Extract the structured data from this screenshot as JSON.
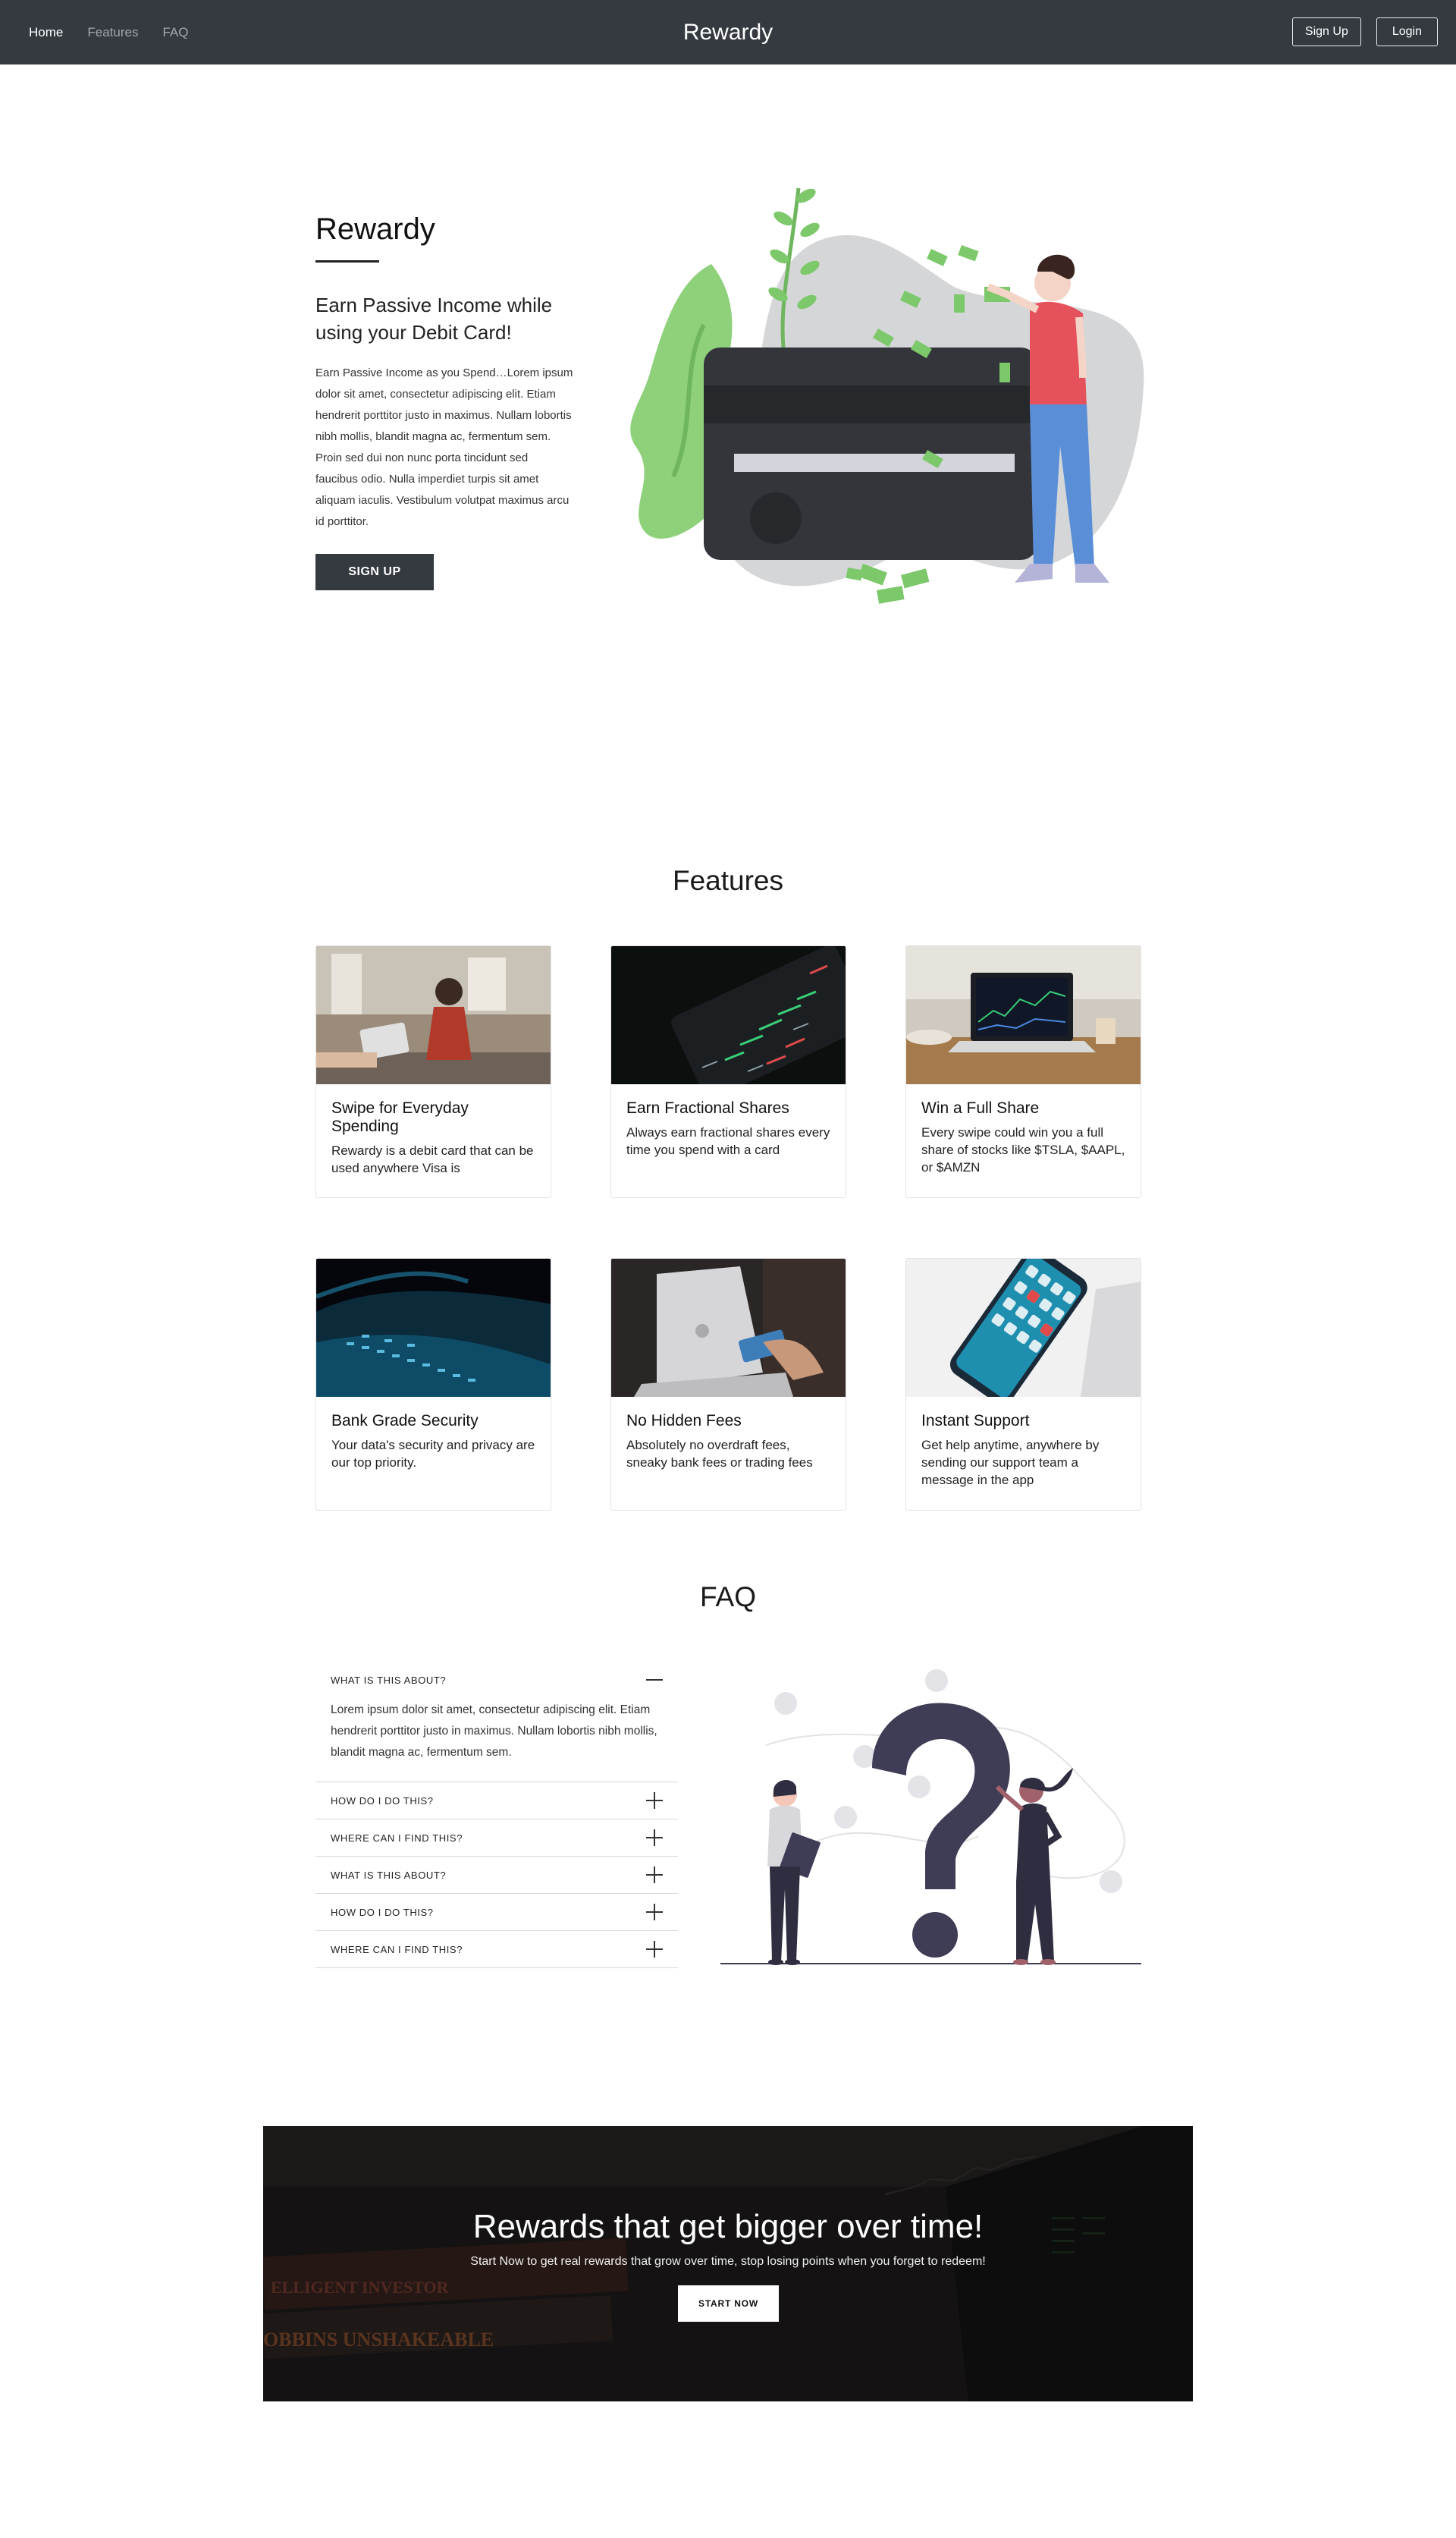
{
  "nav": {
    "links": [
      "Home",
      "Features",
      "FAQ"
    ],
    "brand": "Rewardy",
    "signup": "Sign Up",
    "login": "Login"
  },
  "hero": {
    "title": "Rewardy",
    "subtitle": "Earn Passive Income while using your Debit Card!",
    "body": "Earn Passive Income as you Spend…Lorem ipsum dolor sit amet, consectetur adipiscing elit. Etiam hendrerit porttitor justo in maximus. Nullam lobortis nibh mollis, blandit magna ac, fermentum sem. Proin sed dui non nunc porta tincidunt sed faucibus odio. Nulla imperdiet turpis sit amet aliquam iaculis. Vestibulum volutpat maximus arcu id porttitor.",
    "button": "SIGN UP"
  },
  "features": {
    "title": "Features",
    "cards": [
      {
        "title": "Swipe for Everyday Spending",
        "text": "Rewardy is a debit card that can be used anywhere Visa is"
      },
      {
        "title": "Earn Fractional Shares",
        "text": "Always earn fractional shares every time you spend with a card"
      },
      {
        "title": "Win a Full Share",
        "text": "Every swipe could win you a full share of stocks like $TSLA, $AAPL, or $AMZN"
      },
      {
        "title": "Bank Grade Security",
        "text": "Your data's security and privacy are our top priority."
      },
      {
        "title": "No Hidden Fees",
        "text": "Absolutely no overdraft fees, sneaky bank fees or trading fees"
      },
      {
        "title": "Instant Support",
        "text": "Get help anytime, anywhere by sending our support team a message in the app"
      }
    ]
  },
  "faq": {
    "title": "FAQ",
    "items": [
      {
        "q": "WHAT IS THIS ABOUT?",
        "a": "Lorem ipsum dolor sit amet, consectetur adipiscing elit. Etiam hendrerit porttitor justo in maximus. Nullam lobortis nibh mollis, blandit magna ac, fermentum sem.",
        "open": true
      },
      {
        "q": "HOW DO I DO THIS?",
        "open": false
      },
      {
        "q": "WHERE CAN I FIND THIS?",
        "open": false
      },
      {
        "q": "WHAT IS THIS ABOUT?",
        "open": false
      },
      {
        "q": "HOW DO I DO THIS?",
        "open": false
      },
      {
        "q": "WHERE CAN I FIND THIS?",
        "open": false
      }
    ]
  },
  "cta": {
    "title": "Rewards that get bigger over time!",
    "subtitle": "Start Now to get real rewards that grow over time, stop losing points when you forget to redeem!",
    "button": "START NOW",
    "bg_text_1": "ELLIGENT INVESTOR",
    "bg_text_2": "OBBINS UNSHAKEABLE"
  },
  "colors": {
    "navbar": "#343a40",
    "accent_green": "#7cc86a",
    "card_dark": "#33353b",
    "shirt_red": "#e5525c",
    "pants_blue": "#5a8fd8"
  }
}
